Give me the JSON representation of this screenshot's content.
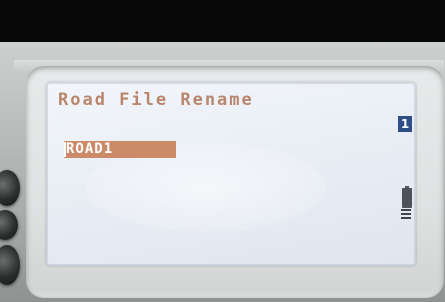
{
  "screen": {
    "title": "Road File Rename",
    "filename_value": "ROAD1",
    "page_number": "1"
  },
  "icons": {
    "battery": "battery-icon",
    "signal": "signal-bars-icon"
  },
  "colors": {
    "title_text": "#b9866d",
    "selection_highlight": "#cc8b68",
    "page_badge": "#2d4f86",
    "lcd_background": "#eaf0f6"
  }
}
